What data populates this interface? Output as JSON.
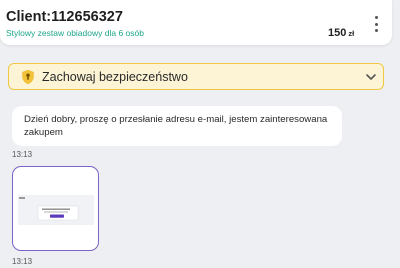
{
  "header": {
    "client_title": "Client:112656327",
    "product_subtitle": "Stylowy zestaw obiadowy dla 6 osób",
    "price": "150",
    "price_unit": "zł"
  },
  "safety_banner": {
    "label": "Zachowaj bezpieczeństwo",
    "icon": "shield-icon",
    "expand_icon": "chevron-down-icon"
  },
  "messages": [
    {
      "text": "Dzień dobry, proszę o przesłanie adresu e-mail, jestem zainteresowana zakupem",
      "time": "13:13"
    },
    {
      "attachment": "screenshot-thumbnail",
      "time": "13:13"
    }
  ],
  "colors": {
    "accent_green": "#1ea58a",
    "banner_bg": "#fdf4d6",
    "banner_border": "#f0c744",
    "attachment_border": "#7b63c7"
  }
}
